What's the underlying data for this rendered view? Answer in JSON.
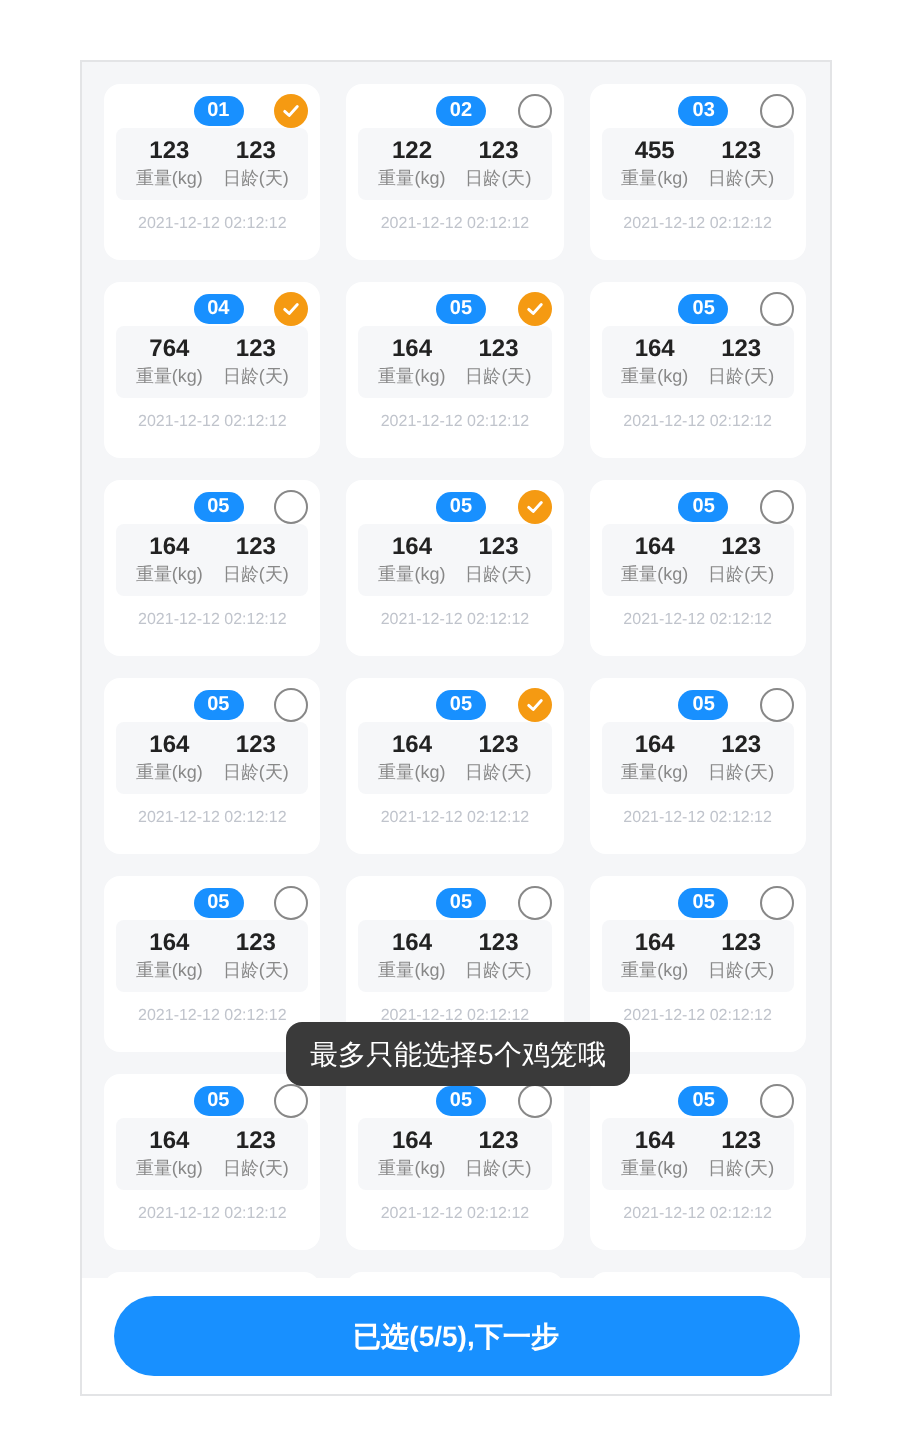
{
  "cages": [
    {
      "number": "01",
      "selected": true,
      "weight": "123",
      "weight_label": "重量(kg)",
      "age": "123",
      "age_label": "日龄(天)",
      "time": "2021-12-12 02:12:12"
    },
    {
      "number": "02",
      "selected": false,
      "weight": "122",
      "weight_label": "重量(kg)",
      "age": "123",
      "age_label": "日龄(天)",
      "time": "2021-12-12 02:12:12"
    },
    {
      "number": "03",
      "selected": false,
      "weight": "455",
      "weight_label": "重量(kg)",
      "age": "123",
      "age_label": "日龄(天)",
      "time": "2021-12-12 02:12:12"
    },
    {
      "number": "04",
      "selected": true,
      "weight": "764",
      "weight_label": "重量(kg)",
      "age": "123",
      "age_label": "日龄(天)",
      "time": "2021-12-12 02:12:12"
    },
    {
      "number": "05",
      "selected": true,
      "weight": "164",
      "weight_label": "重量(kg)",
      "age": "123",
      "age_label": "日龄(天)",
      "time": "2021-12-12 02:12:12"
    },
    {
      "number": "05",
      "selected": false,
      "weight": "164",
      "weight_label": "重量(kg)",
      "age": "123",
      "age_label": "日龄(天)",
      "time": "2021-12-12 02:12:12"
    },
    {
      "number": "05",
      "selected": false,
      "weight": "164",
      "weight_label": "重量(kg)",
      "age": "123",
      "age_label": "日龄(天)",
      "time": "2021-12-12 02:12:12"
    },
    {
      "number": "05",
      "selected": true,
      "weight": "164",
      "weight_label": "重量(kg)",
      "age": "123",
      "age_label": "日龄(天)",
      "time": "2021-12-12 02:12:12"
    },
    {
      "number": "05",
      "selected": false,
      "weight": "164",
      "weight_label": "重量(kg)",
      "age": "123",
      "age_label": "日龄(天)",
      "time": "2021-12-12 02:12:12"
    },
    {
      "number": "05",
      "selected": false,
      "weight": "164",
      "weight_label": "重量(kg)",
      "age": "123",
      "age_label": "日龄(天)",
      "time": "2021-12-12 02:12:12"
    },
    {
      "number": "05",
      "selected": true,
      "weight": "164",
      "weight_label": "重量(kg)",
      "age": "123",
      "age_label": "日龄(天)",
      "time": "2021-12-12 02:12:12"
    },
    {
      "number": "05",
      "selected": false,
      "weight": "164",
      "weight_label": "重量(kg)",
      "age": "123",
      "age_label": "日龄(天)",
      "time": "2021-12-12 02:12:12"
    },
    {
      "number": "05",
      "selected": false,
      "weight": "164",
      "weight_label": "重量(kg)",
      "age": "123",
      "age_label": "日龄(天)",
      "time": "2021-12-12 02:12:12"
    },
    {
      "number": "05",
      "selected": false,
      "weight": "164",
      "weight_label": "重量(kg)",
      "age": "123",
      "age_label": "日龄(天)",
      "time": "2021-12-12 02:12:12"
    },
    {
      "number": "05",
      "selected": false,
      "weight": "164",
      "weight_label": "重量(kg)",
      "age": "123",
      "age_label": "日龄(天)",
      "time": "2021-12-12 02:12:12"
    },
    {
      "number": "05",
      "selected": false,
      "weight": "164",
      "weight_label": "重量(kg)",
      "age": "123",
      "age_label": "日龄(天)",
      "time": "2021-12-12 02:12:12"
    },
    {
      "number": "05",
      "selected": false,
      "weight": "164",
      "weight_label": "重量(kg)",
      "age": "123",
      "age_label": "日龄(天)",
      "time": "2021-12-12 02:12:12"
    },
    {
      "number": "05",
      "selected": false,
      "weight": "164",
      "weight_label": "重量(kg)",
      "age": "123",
      "age_label": "日龄(天)",
      "time": "2021-12-12 02:12:12"
    }
  ],
  "toast": "最多只能选择5个鸡笼哦",
  "next_button": "已选(5/5),下一步"
}
